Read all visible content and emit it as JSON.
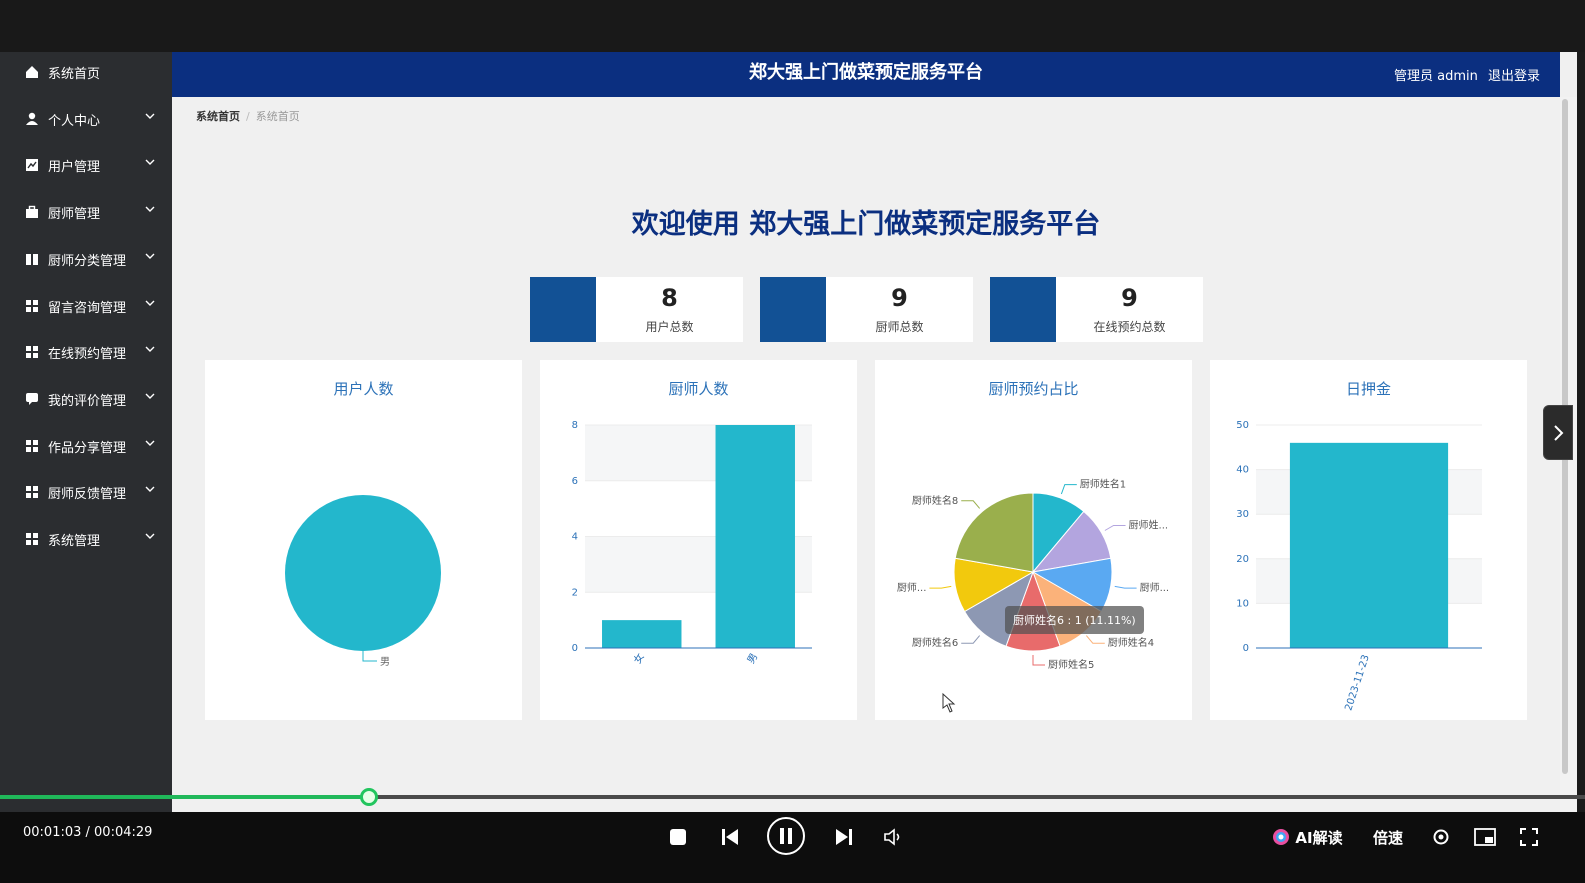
{
  "header": {
    "title": "郑大强上门做菜预定服务平台",
    "user": "管理员 admin",
    "logout": "退出登录"
  },
  "sidebar": {
    "items": [
      {
        "label": "系统首页",
        "icon": "home-icon",
        "has_chevron": false
      },
      {
        "label": "个人中心",
        "icon": "user-icon",
        "has_chevron": true
      },
      {
        "label": "用户管理",
        "icon": "chart-icon",
        "has_chevron": true
      },
      {
        "label": "厨师管理",
        "icon": "briefcase-icon",
        "has_chevron": true
      },
      {
        "label": "厨师分类管理",
        "icon": "book-icon",
        "has_chevron": true
      },
      {
        "label": "留言咨询管理",
        "icon": "grid-icon",
        "has_chevron": true
      },
      {
        "label": "在线预约管理",
        "icon": "grid-icon",
        "has_chevron": true
      },
      {
        "label": "我的评价管理",
        "icon": "comment-icon",
        "has_chevron": true
      },
      {
        "label": "作品分享管理",
        "icon": "grid-icon",
        "has_chevron": true
      },
      {
        "label": "厨师反馈管理",
        "icon": "grid-icon",
        "has_chevron": true
      },
      {
        "label": "系统管理",
        "icon": "grid-icon",
        "has_chevron": true
      }
    ]
  },
  "breadcrumb": {
    "root": "系统首页",
    "sep": "/",
    "current": "系统首页"
  },
  "welcome": "欢迎使用 郑大强上门做菜预定服务平台",
  "stats": [
    {
      "value": "8",
      "label": "用户总数"
    },
    {
      "value": "9",
      "label": "厨师总数"
    },
    {
      "value": "9",
      "label": "在线预约总数"
    }
  ],
  "colors": {
    "header_bg": "#0b2f80",
    "stat_block": "#125195",
    "chart_teal": "#23b7cc",
    "sidebar_bg": "#2b2d30",
    "progress": "#22c55e"
  },
  "chart_data": [
    {
      "type": "pie",
      "title": "用户人数",
      "slices": [
        {
          "label": "男",
          "value": 8
        }
      ]
    },
    {
      "type": "bar",
      "title": "厨师人数",
      "categories": [
        "女",
        "男"
      ],
      "values": [
        1,
        8
      ],
      "ylim": [
        0,
        8
      ],
      "yticks": [
        "0",
        "2",
        "4",
        "6",
        "8"
      ],
      "grid": true
    },
    {
      "type": "pie",
      "title": "厨师预约占比",
      "slices": [
        {
          "label": "厨师姓名1",
          "value": 1,
          "color": "#23b7cc"
        },
        {
          "label": "厨师姓...",
          "value": 1,
          "color": "#b3a5df"
        },
        {
          "label": "厨师...",
          "value": 1,
          "color": "#5aa9f2"
        },
        {
          "label": "厨师姓名4",
          "value": 1,
          "color": "#fbb27a"
        },
        {
          "label": "厨师姓名5",
          "value": 1,
          "color": "#e86b6b"
        },
        {
          "label": "厨师姓名6",
          "value": 1,
          "color": "#8d98b3"
        },
        {
          "label": "厨师...",
          "value": 1,
          "color": "#f2c90d"
        },
        {
          "label": "厨师姓名8",
          "value": 2,
          "color": "#9aaf4c"
        }
      ],
      "tooltip": "厨师姓名6 : 1 (11.11%)"
    },
    {
      "type": "bar",
      "title": "日押金",
      "categories": [
        "2023-11-23"
      ],
      "values": [
        46
      ],
      "ylim": [
        0,
        50
      ],
      "yticks": [
        "0",
        "10",
        "20",
        "30",
        "40",
        "50"
      ],
      "grid": true
    }
  ],
  "player": {
    "time": "00:01:03 / 00:04:29",
    "progress": 0.235,
    "ai_label": "AI解读",
    "speed_label": "倍速"
  }
}
